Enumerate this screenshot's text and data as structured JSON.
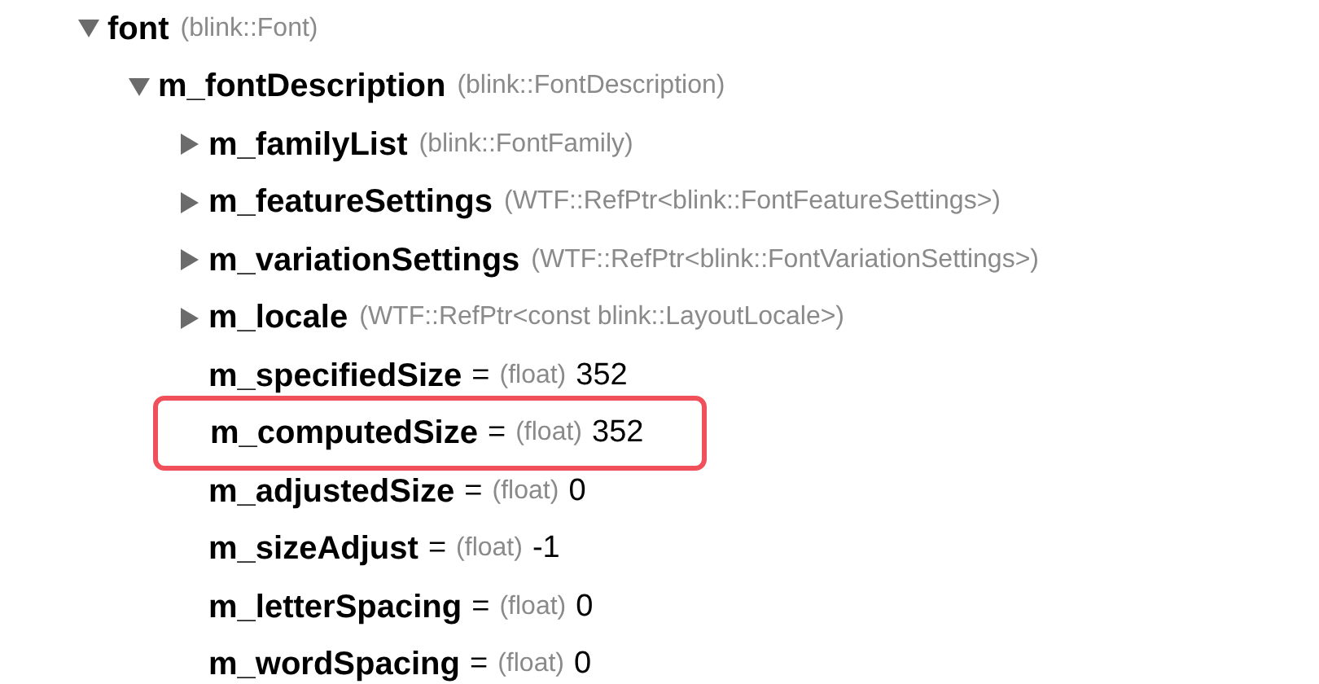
{
  "tree": [
    {
      "kind": "group",
      "name": "font",
      "type": "(blink::Font)",
      "expanded": true,
      "children": [
        {
          "kind": "group",
          "name": "m_fontDescription",
          "type": "(blink::FontDescription)",
          "expanded": true,
          "children": [
            {
              "kind": "group",
              "name": "m_familyList",
              "type": "(blink::FontFamily)",
              "expanded": false
            },
            {
              "kind": "group",
              "name": "m_featureSettings",
              "type": "(WTF::RefPtr<blink::FontFeatureSettings>)",
              "expanded": false
            },
            {
              "kind": "group",
              "name": "m_variationSettings",
              "type": "(WTF::RefPtr<blink::FontVariationSettings>)",
              "expanded": false
            },
            {
              "kind": "group",
              "name": "m_locale",
              "type": "(WTF::RefPtr<const blink::LayoutLocale>)",
              "expanded": false
            },
            {
              "kind": "leaf",
              "name": "m_specifiedSize",
              "operator": "=",
              "type": "(float)",
              "value": "352",
              "highlighted": false
            },
            {
              "kind": "leaf",
              "name": "m_computedSize",
              "operator": "=",
              "type": "(float)",
              "value": "352",
              "highlighted": true
            },
            {
              "kind": "leaf",
              "name": "m_adjustedSize",
              "operator": "=",
              "type": "(float)",
              "value": "0",
              "highlighted": false
            },
            {
              "kind": "leaf",
              "name": "m_sizeAdjust",
              "operator": "=",
              "type": "(float)",
              "value": "-1",
              "highlighted": false
            },
            {
              "kind": "leaf",
              "name": "m_letterSpacing",
              "operator": "=",
              "type": "(float)",
              "value": "0",
              "highlighted": false
            },
            {
              "kind": "leaf",
              "name": "m_wordSpacing",
              "operator": "=",
              "type": "(float)",
              "value": "0",
              "highlighted": false
            }
          ]
        }
      ]
    }
  ]
}
